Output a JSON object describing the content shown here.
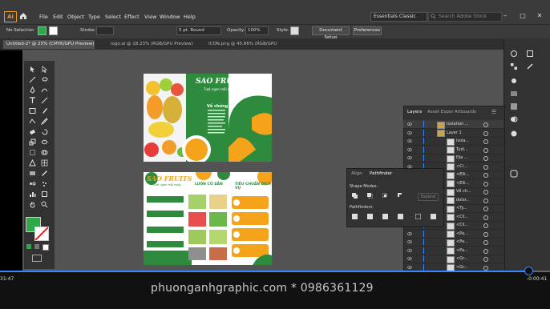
{
  "app": {
    "logo_text": "Ai"
  },
  "menu": {
    "items": [
      "File",
      "Edit",
      "Object",
      "Type",
      "Select",
      "Effect",
      "View",
      "Window",
      "Help"
    ]
  },
  "workspace": {
    "label": "Essentials Classic"
  },
  "search": {
    "placeholder": "Search Adobe Stock"
  },
  "control_bar": {
    "selection_label": "No Selection",
    "stroke_label": "Stroke:",
    "brush_value": "5 pt. Round",
    "opacity_label": "Opacity:",
    "opacity_value": "100%",
    "style_label": "Style:",
    "doc_setup_label": "Document Setup",
    "preferences_label": "Preferences"
  },
  "doc_tabs": [
    "Untitled-2* @ 25% (CMYK/GPU Preview)",
    "logo.ai @ 18.23% (RGB/GPU Preview)",
    "ICON.png @ 45.86% (RGB/GPU Preview)"
  ],
  "artboard": {
    "brand": "SAO FRUITS",
    "tagline": "Tươi ngon mỗi ngày",
    "about_title": "Về chúng tôi",
    "products_title": "LUÔN CÓ SẴN",
    "standards_title": "TIÊU CHUẨN DỊCH VỤ"
  },
  "layers_panel": {
    "tabs": [
      "Layers",
      "Asset Expor",
      "Artboards"
    ],
    "rows": [
      "Isolation ...",
      "Layer 1",
      "Isola...",
      "Tuởi...",
      "Địa ...",
      "<Cl...",
      "<Elli...",
      "<Elli...",
      "Về ch...",
      "dolor...",
      "<Ty...",
      "<Cli...",
      "<Cli...",
      "<Pa...",
      "<Pa...",
      "<Pa...",
      "<Gr...",
      "<Gr...",
      "<Pa..."
    ]
  },
  "pathfinder_panel": {
    "tabs": [
      "Align",
      "Pathfinder"
    ],
    "shape_modes_label": "Shape Modes:",
    "expand_label": "Expand",
    "pathfinders_label": "Pathfinders:"
  },
  "video": {
    "current_time": "31:47",
    "remaining_time": "-0:00:41",
    "progress": 0.96,
    "watermark": "phuonganhgraphic.com * 0986361129"
  },
  "colors": {
    "accent": "#3a86ff",
    "brand_green": "#2e8b3e",
    "brand_orange": "#f5a31a"
  }
}
